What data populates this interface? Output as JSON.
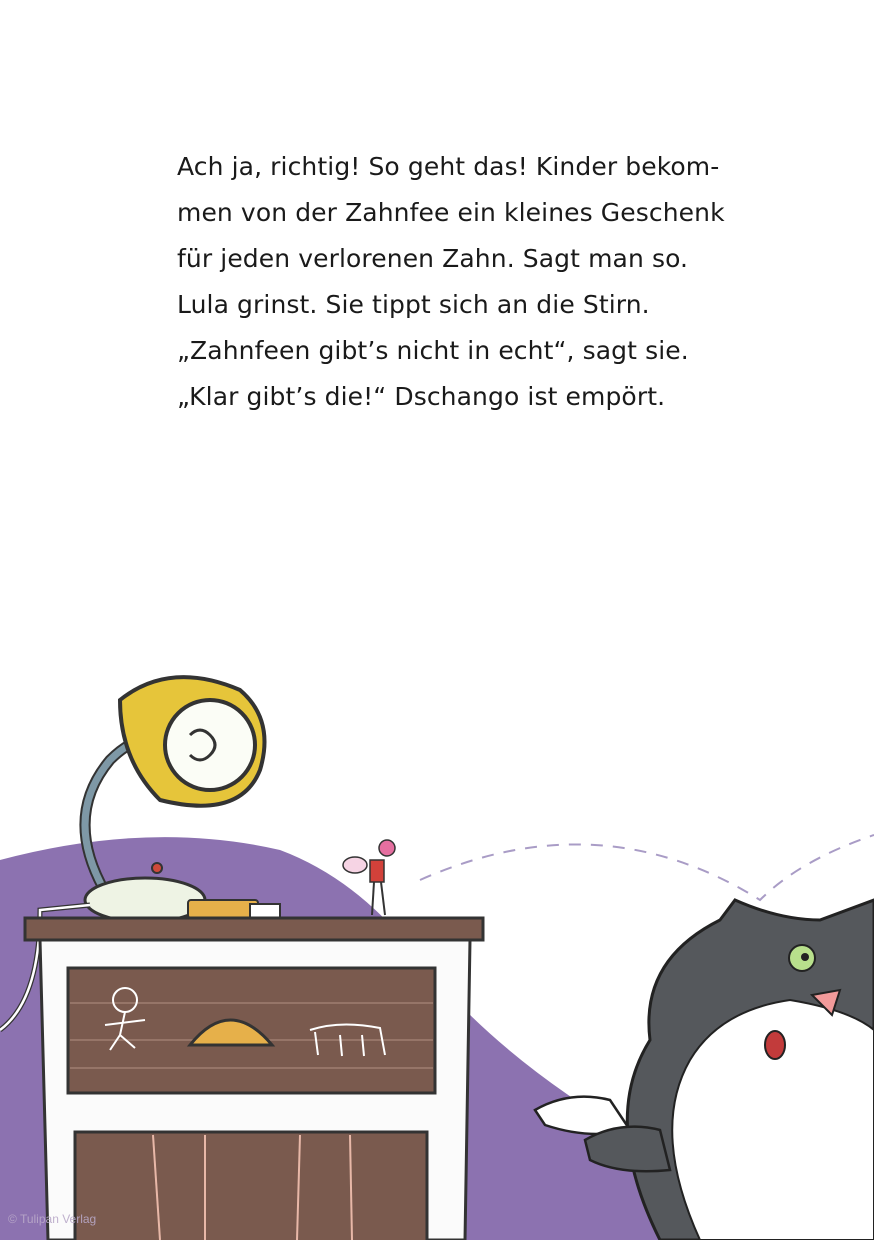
{
  "story": {
    "lines": [
      "Ach ja, richtig! So geht das! Kinder bekom-",
      "men von der Zahnfee ein kleines Geschenk",
      "für jeden verlorenen Zahn. Sagt man so.",
      "Lula grinst. Sie tippt sich an die Stirn.",
      "„Zahnfeen gibt’s nicht in echt“, sagt sie.",
      "„Klar gibt’s die!“ Dschango ist empört."
    ]
  },
  "illustration": {
    "copyright": "© Tulipan Verlag",
    "colors": {
      "purple": "#8c72b0",
      "drawer": "#7a5a4e",
      "lamp_shade": "#e6c53a",
      "cat_fur": "#55585c"
    }
  }
}
